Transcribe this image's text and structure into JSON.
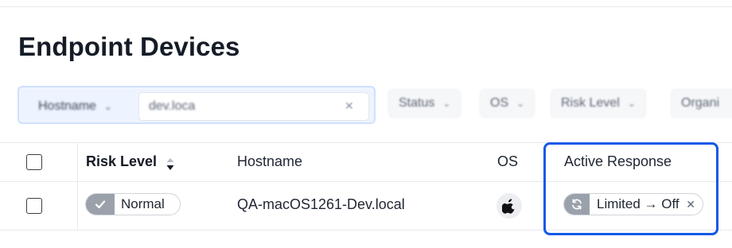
{
  "page": {
    "title": "Endpoint Devices"
  },
  "filters": {
    "field_selector": "Hostname",
    "search_value": "dev.loca",
    "chips": [
      "Status",
      "OS",
      "Risk Level",
      "Organi"
    ]
  },
  "table": {
    "columns": {
      "risk_level": "Risk Level",
      "hostname": "Hostname",
      "os": "OS",
      "active_response": "Active Response"
    },
    "rows": [
      {
        "risk_level": "Normal",
        "hostname": "QA-macOS1261-Dev.local",
        "os": "apple-icon",
        "active_response": "Limited → Off"
      }
    ]
  },
  "colors": {
    "highlight": "#1459e6",
    "badge_icon_bg": "#9aa1ab"
  }
}
